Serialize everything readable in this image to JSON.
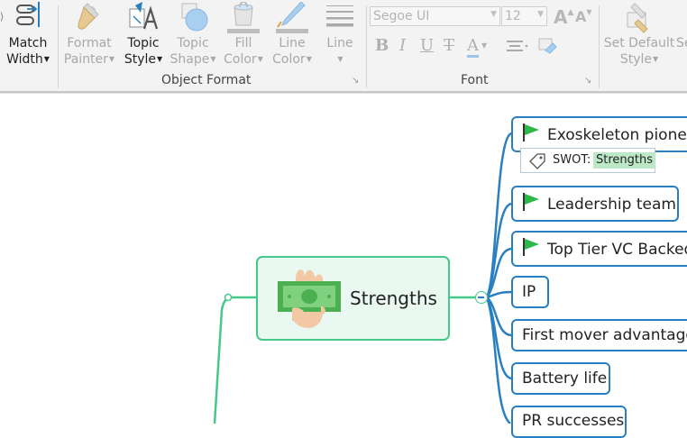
{
  "ribbon": {
    "match_width": {
      "line1": "Match",
      "line2": "Width"
    },
    "format_painter": {
      "line1": "Format",
      "line2": "Painter"
    },
    "topic_style": {
      "line1": "Topic",
      "line2": "Style"
    },
    "topic_shape": {
      "line1": "Topic",
      "line2": "Shape"
    },
    "fill_color": {
      "line1": "Fill",
      "line2": "Color"
    },
    "line_color": {
      "line1": "Line",
      "line2": "Color"
    },
    "line": {
      "line1": "Line"
    },
    "set_default_style": {
      "line1": "Set Default",
      "line2": "Style"
    },
    "cut_off_next": "Se",
    "group_object_format": "Object Format",
    "group_font": "Font",
    "font_name": "Segoe UI",
    "font_size": "12",
    "grow_font": "A",
    "shrink_font": "A",
    "bold": "B",
    "italic": "I",
    "underline": "U",
    "strike": "T",
    "font_color": "A"
  },
  "map": {
    "central_topic": "Strengths",
    "subtopics": [
      {
        "label": "Exoskeleton pionee",
        "flag": true
      },
      {
        "label": "Leadership team",
        "flag": true
      },
      {
        "label": "Top Tier VC Backed",
        "flag": true
      },
      {
        "label": "IP",
        "flag": false
      },
      {
        "label": "First mover advantage",
        "flag": false
      },
      {
        "label": "Battery life",
        "flag": false
      },
      {
        "label": "PR successes",
        "flag": false
      }
    ],
    "tag": {
      "key": "SWOT:",
      "value": "Strengths"
    },
    "colors": {
      "branch": "#2a7fc0",
      "central_border": "#45c98a",
      "central_fill": "#e9f8f0",
      "flag": "#2db84a",
      "tag_highlight": "#bde8c6"
    }
  }
}
